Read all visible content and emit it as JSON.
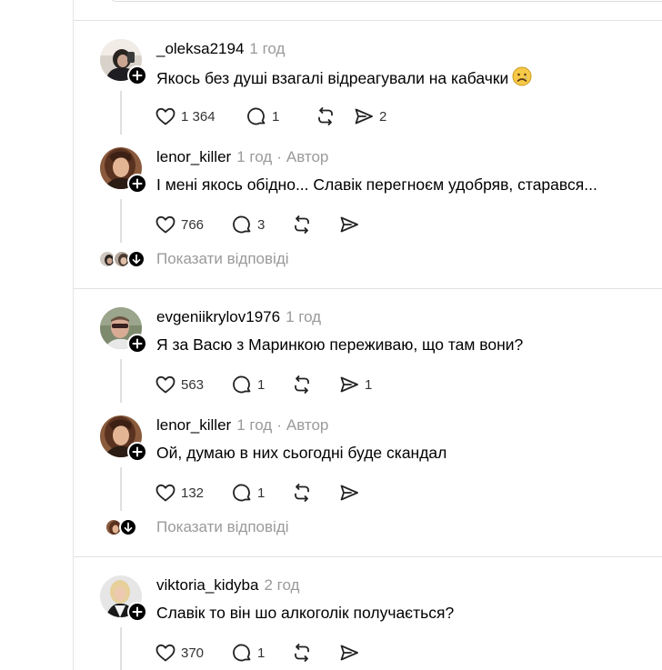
{
  "comments": [
    {
      "username": "_oleksa2194",
      "time": "1 год",
      "author_tag": "",
      "text": "Якось без душі взагалі відреагували на кабачки",
      "emoji": "sad-face-emoji",
      "likes": "1 364",
      "replies": "1",
      "reposts": "",
      "shares": "2"
    },
    {
      "username": "lenor_killer",
      "time": "1 год",
      "author_tag": "Автор",
      "text": "І мені якось обідно... Славік перегноєм удобряв, старався...",
      "likes": "766",
      "replies": "3",
      "reposts": "",
      "shares": ""
    },
    {
      "username": "evgeniikrylov1976",
      "time": "1 год",
      "author_tag": "",
      "text": "Я за Васю з Маринкою переживаю, що там вони?",
      "likes": "563",
      "replies": "1",
      "reposts": "",
      "shares": "1"
    },
    {
      "username": "lenor_killer",
      "time": "1 год",
      "author_tag": "Автор",
      "text": "Ой, думаю в них сьогодні буде скандал",
      "likes": "132",
      "replies": "1",
      "reposts": "",
      "shares": ""
    },
    {
      "username": "viktoria_kidyba",
      "time": "2 год",
      "author_tag": "",
      "text": "Славік то він шо алкоголік получається?",
      "likes": "370",
      "replies": "1",
      "reposts": "",
      "shares": ""
    }
  ],
  "show_replies_label": "Показати відповіді",
  "icons": {
    "like": "heart-icon",
    "reply": "comment-bubble-icon",
    "repost": "repost-icon",
    "share": "send-icon",
    "follow": "plus-icon",
    "expand": "arrow-down-icon"
  },
  "colors": {
    "muted_text": "#9a9a9a",
    "divider": "#e2e2e2",
    "badge": "#000000"
  }
}
